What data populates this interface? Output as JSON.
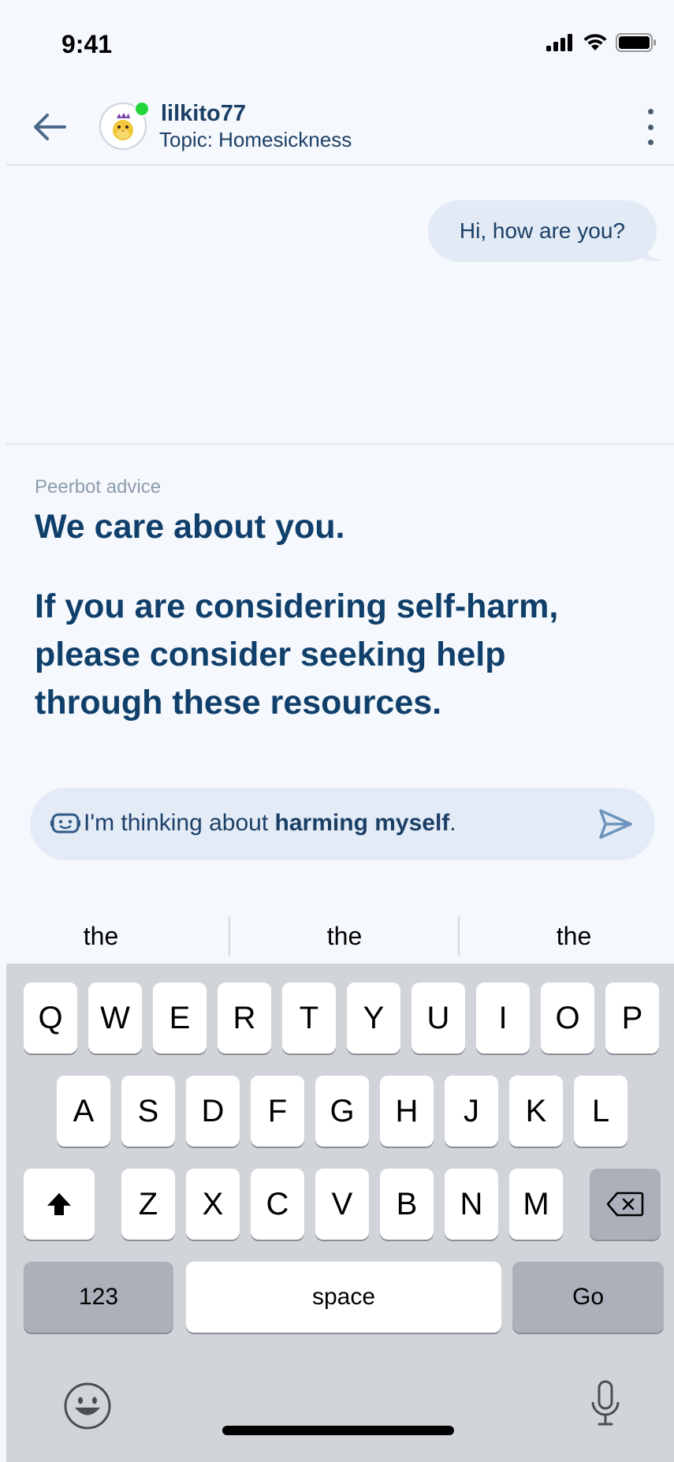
{
  "status_bar": {
    "time": "9:41"
  },
  "header": {
    "username": "lilkito77",
    "topic": "Topic: Homesickness"
  },
  "chat": {
    "messages": [
      {
        "text": "Hi, how are you?"
      }
    ]
  },
  "advice": {
    "label": "Peerbot advice",
    "title": "We care about you.",
    "body": "If you are considering self-harm, please consider seeking help through these resources."
  },
  "compose": {
    "prefix": "I'm thinking about ",
    "bold": "harming myself",
    "suffix": "."
  },
  "suggestions": [
    "the",
    "the",
    "the"
  ],
  "keyboard": {
    "row1": [
      "Q",
      "W",
      "E",
      "R",
      "T",
      "Y",
      "U",
      "I",
      "O",
      "P"
    ],
    "row2": [
      "A",
      "S",
      "D",
      "F",
      "G",
      "H",
      "J",
      "K",
      "L"
    ],
    "row3": [
      "Z",
      "X",
      "C",
      "V",
      "B",
      "N",
      "M"
    ],
    "numbers_label": "123",
    "space_label": "space",
    "go_label": "Go"
  }
}
